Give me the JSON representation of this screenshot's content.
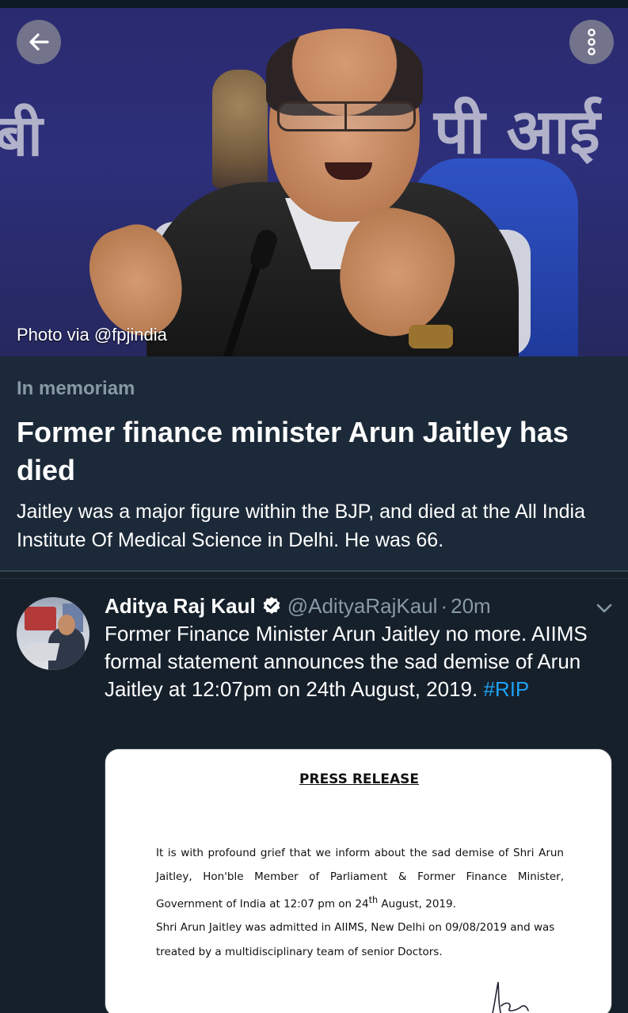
{
  "hero": {
    "photo_credit": "Photo via @fpjindia",
    "backdrop_text_left": "बी",
    "backdrop_text_right": "पी आई"
  },
  "toolbar": {
    "back_icon": "arrow-left-icon",
    "more_icon": "more-vertical-icon"
  },
  "event": {
    "category": "In memoriam",
    "title": "Former finance minister Arun Jaitley has died",
    "description": "Jaitley was a major figure within the BJP, and died at the All India Institute Of Medical Science in Delhi. He was 66."
  },
  "tweet": {
    "author_name": "Aditya Raj Kaul",
    "handle": "@AdityaRajKaul",
    "separator": "·",
    "time": "20m",
    "text": "Former Finance Minister Arun Jaitley no more. AIIMS formal statement announces the sad demise of Arun Jaitley at 12:07pm on 24th August, 2019.",
    "hashtag": "#RIP",
    "verified_icon": "verified-badge-icon",
    "menu_icon": "chevron-down-icon"
  },
  "press_release": {
    "title": "PRESS RELEASE",
    "para1_a": "It is with profound grief that we inform about the sad demise of Shri Arun Jaitley, Hon'ble Member of Parliament & Former Finance Minister, Government of India at 12:07 pm on 24",
    "para1_sup": "th",
    "para1_b": " August, 2019.",
    "para2": "Shri Arun Jaitley was admitted in AIIMS, New Delhi on 09/08/2019 and was treated by a multidisciplinary team of senior Doctors."
  },
  "colors": {
    "background": "#15202b",
    "card": "#1c2938",
    "secondary_text": "#8899a6",
    "link": "#1da1f2"
  }
}
